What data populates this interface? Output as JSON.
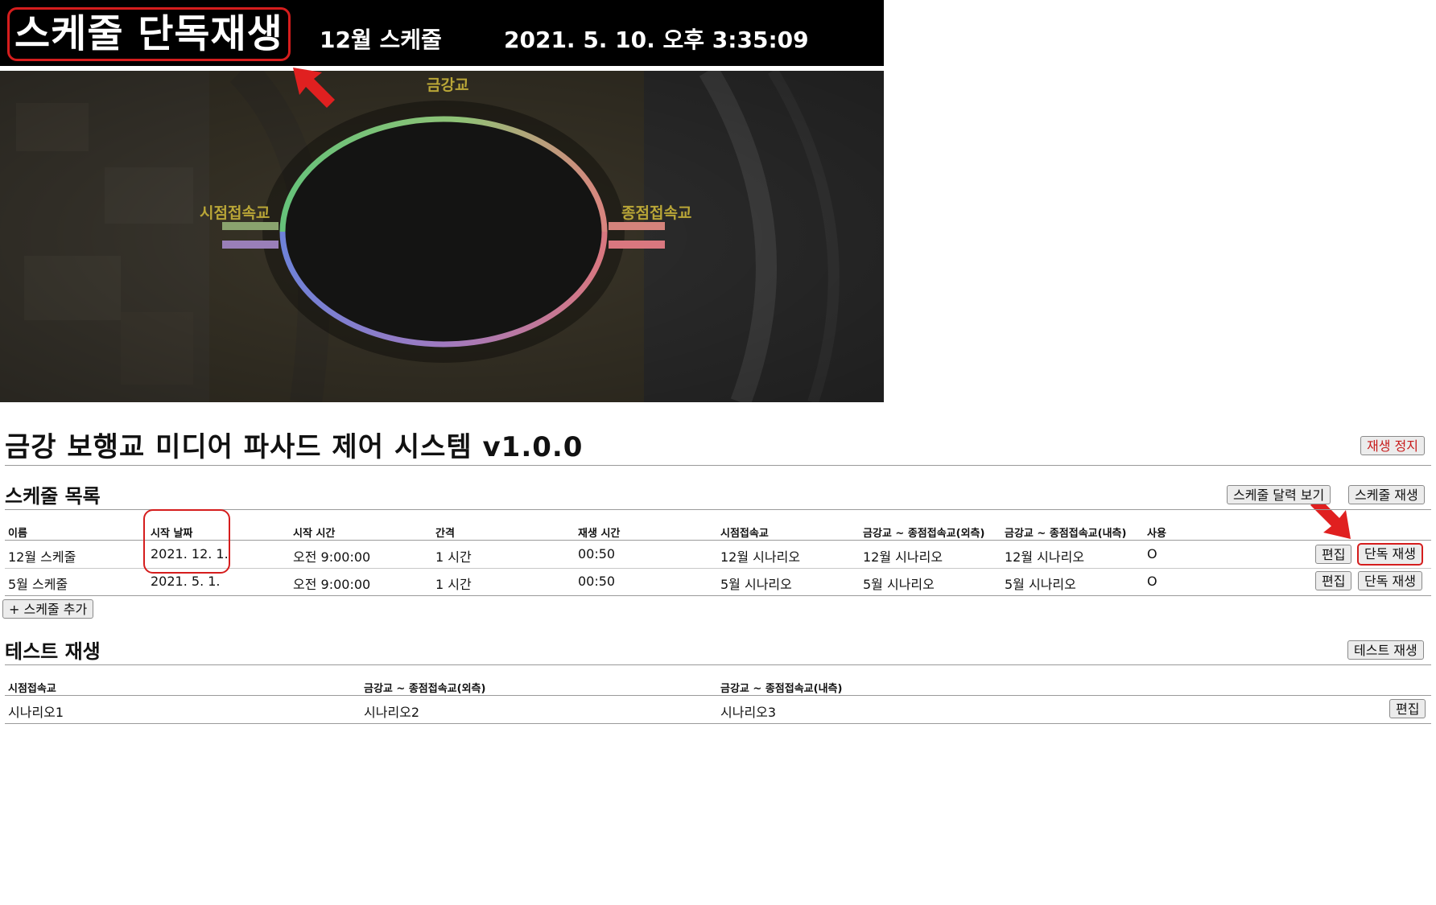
{
  "preview": {
    "mode_title": "스케줄 단독재생",
    "schedule_name": "12월 스케줄",
    "clock": "2021. 5. 10. 오후 3:35:09",
    "bridge_labels": {
      "top": "금강교",
      "left": "시점접속교",
      "right": "종점접속교"
    }
  },
  "system": {
    "title": "금강 보행교 미디어 파사드 제어 시스템 v1.0.0",
    "stop_button": "재생 정지"
  },
  "schedule_section": {
    "heading": "스케줄 목록",
    "calendar_button": "스케줄 달력 보기",
    "play_button": "스케줄 재생",
    "columns": [
      "이름",
      "시작 날짜",
      "시작 시간",
      "간격",
      "재생 시간",
      "시점접속교",
      "금강교 ~ 종점접속교(외측)",
      "금강교 ~ 종점접속교(내측)",
      "사용"
    ],
    "rows": [
      {
        "name": "12월 스케줄",
        "start_date": "2021. 12. 1.",
        "start_time": "오전 9:00:00",
        "interval": "1 시간",
        "play_time": "00:50",
        "start_bridge": "12월 시나리오",
        "outer": "12월 시나리오",
        "inner": "12월 시나리오",
        "use": "O",
        "edit": "편집",
        "solo": "단독 재생"
      },
      {
        "name": "5월 스케줄",
        "start_date": "2021. 5. 1.",
        "start_time": "오전 9:00:00",
        "interval": "1 시간",
        "play_time": "00:50",
        "start_bridge": "5월 시나리오",
        "outer": "5월 시나리오",
        "inner": "5월 시나리오",
        "use": "O",
        "edit": "편집",
        "solo": "단독 재생"
      }
    ],
    "add_button": "+ 스케줄 추가"
  },
  "test_section": {
    "heading": "테스트 재생",
    "play_button": "테스트 재생",
    "columns": [
      "시점접속교",
      "금강교 ~ 종점접속교(외측)",
      "금강교 ~ 종점접속교(내측)"
    ],
    "row": {
      "c1": "시나리오1",
      "c2": "시나리오2",
      "c3": "시나리오3",
      "edit": "편집"
    }
  },
  "colors": {
    "highlight": "#d51d1d",
    "bridge_label": "#b9a637",
    "ring_green": "#6fbf73",
    "ring_blue": "#7b86d6",
    "ring_pink": "#d9777f"
  }
}
